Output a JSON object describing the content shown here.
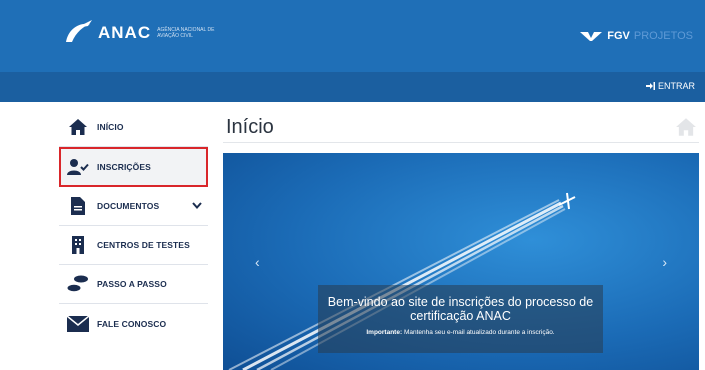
{
  "header": {
    "logo_text": "ANAC",
    "logo_subtitle": "Agência Nacional de Aviação Civil",
    "partner_name": "FGV",
    "partner_suffix": "PROJETOS",
    "colors": {
      "primary": "#1f6fb7",
      "secondary": "#1b5fa0"
    }
  },
  "topbar": {
    "login_label": "ENTRAR",
    "login_icon": "sign-in-icon"
  },
  "sidebar": {
    "items": [
      {
        "label": "INÍCIO",
        "icon": "home-icon"
      },
      {
        "label": "INSCRIÇÕES",
        "icon": "user-check-icon",
        "selected": true
      },
      {
        "label": "DOCUMENTOS",
        "icon": "document-icon",
        "has_submenu": true
      },
      {
        "label": "CENTROS DE TESTES",
        "icon": "building-icon"
      },
      {
        "label": "PASSO A PASSO",
        "icon": "footsteps-icon"
      },
      {
        "label": "FALE CONOSCO",
        "icon": "envelope-icon"
      }
    ]
  },
  "main": {
    "title": "Início",
    "banner": {
      "headline": "Bem-vindo ao site de inscrições do processo de certificação ANAC",
      "note_label": "Importante:",
      "note_text": "Mantenha seu e-mail atualizado durante a inscrição.",
      "prev_label": "‹",
      "next_label": "›"
    }
  }
}
